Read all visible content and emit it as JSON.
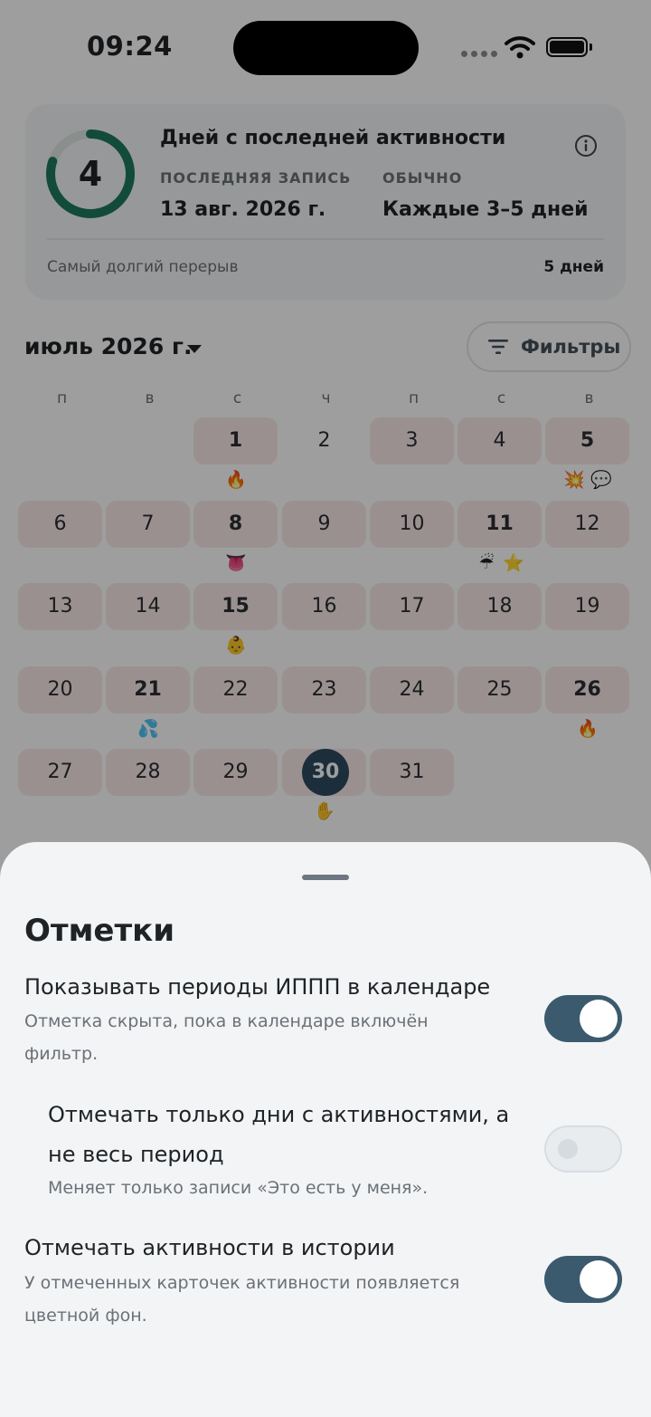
{
  "status_bar": {
    "time": "09:24"
  },
  "summary": {
    "days": "4",
    "progress": 0.8,
    "title": "Дней с последней активности",
    "last_label": "ПОСЛЕДНЯЯ ЗАПИСЬ",
    "last_value": "13 авг. 2026 г.",
    "usual_label": "ОБЫЧНО",
    "usual_value": "Каждые 3–5 дней",
    "longest_gap_label": "Самый долгий перерыв",
    "longest_gap_value": "5 дней"
  },
  "calendar": {
    "month": "июль 2026 г.",
    "filters_label": "Фильтры",
    "weekdays": [
      "п",
      "в",
      "с",
      "ч",
      "п",
      "с",
      "в"
    ],
    "days": [
      {
        "n": "1",
        "mark": true,
        "bold": true,
        "emoji": [
          "🔥"
        ]
      },
      {
        "n": "2",
        "mark": false,
        "bold": false,
        "emoji": []
      },
      {
        "n": "3",
        "mark": true,
        "bold": false,
        "emoji": []
      },
      {
        "n": "4",
        "mark": true,
        "bold": false,
        "emoji": []
      },
      {
        "n": "5",
        "mark": true,
        "bold": true,
        "emoji": [
          "💥",
          "💬"
        ]
      },
      {
        "n": "6",
        "mark": true,
        "bold": false,
        "emoji": []
      },
      {
        "n": "7",
        "mark": true,
        "bold": false,
        "emoji": []
      },
      {
        "n": "8",
        "mark": true,
        "bold": true,
        "emoji": [
          "👅"
        ]
      },
      {
        "n": "9",
        "mark": true,
        "bold": false,
        "emoji": []
      },
      {
        "n": "10",
        "mark": true,
        "bold": false,
        "emoji": []
      },
      {
        "n": "11",
        "mark": true,
        "bold": true,
        "emoji": [
          "☔",
          "⭐"
        ]
      },
      {
        "n": "12",
        "mark": true,
        "bold": false,
        "emoji": []
      },
      {
        "n": "13",
        "mark": true,
        "bold": false,
        "emoji": []
      },
      {
        "n": "14",
        "mark": true,
        "bold": false,
        "emoji": []
      },
      {
        "n": "15",
        "mark": true,
        "bold": true,
        "emoji": [
          "👶"
        ]
      },
      {
        "n": "16",
        "mark": true,
        "bold": false,
        "emoji": []
      },
      {
        "n": "17",
        "mark": true,
        "bold": false,
        "emoji": []
      },
      {
        "n": "18",
        "mark": true,
        "bold": false,
        "emoji": []
      },
      {
        "n": "19",
        "mark": true,
        "bold": false,
        "emoji": []
      },
      {
        "n": "20",
        "mark": true,
        "bold": false,
        "emoji": []
      },
      {
        "n": "21",
        "mark": true,
        "bold": true,
        "emoji": [
          "💦"
        ]
      },
      {
        "n": "22",
        "mark": true,
        "bold": false,
        "emoji": []
      },
      {
        "n": "23",
        "mark": true,
        "bold": false,
        "emoji": []
      },
      {
        "n": "24",
        "mark": true,
        "bold": false,
        "emoji": []
      },
      {
        "n": "25",
        "mark": true,
        "bold": false,
        "emoji": []
      },
      {
        "n": "26",
        "mark": true,
        "bold": true,
        "emoji": [
          "🔥"
        ]
      },
      {
        "n": "27",
        "mark": true,
        "bold": false,
        "emoji": []
      },
      {
        "n": "28",
        "mark": true,
        "bold": false,
        "emoji": []
      },
      {
        "n": "29",
        "mark": true,
        "bold": false,
        "emoji": []
      },
      {
        "n": "30",
        "mark": true,
        "bold": true,
        "today": true,
        "emoji": [
          "✋"
        ]
      },
      {
        "n": "31",
        "mark": true,
        "bold": false,
        "emoji": []
      }
    ]
  },
  "sheet": {
    "title": "Отметки",
    "row1": {
      "title": "Показывать периоды ИППП в календаре",
      "sub_line1": "Отметка скрыта, пока в календаре включён",
      "sub_line2": "фильтр.",
      "enabled": true
    },
    "row2": {
      "title_line1": "Отмечать только дни с активностями, а",
      "title_line2": "не весь период",
      "sub": "Меняет только записи «Это есть у меня».",
      "enabled": false
    },
    "row3": {
      "title": "Отмечать активности в истории",
      "sub_line1": "У отмеченных карточек активности появляется",
      "sub_line2": "цветной фон.",
      "enabled": true
    }
  },
  "colors": {
    "accent": "#3c5a6e",
    "ring": "#1e7a5e",
    "marked_day": "#fbe9e9",
    "today": "#2e4b5f"
  }
}
